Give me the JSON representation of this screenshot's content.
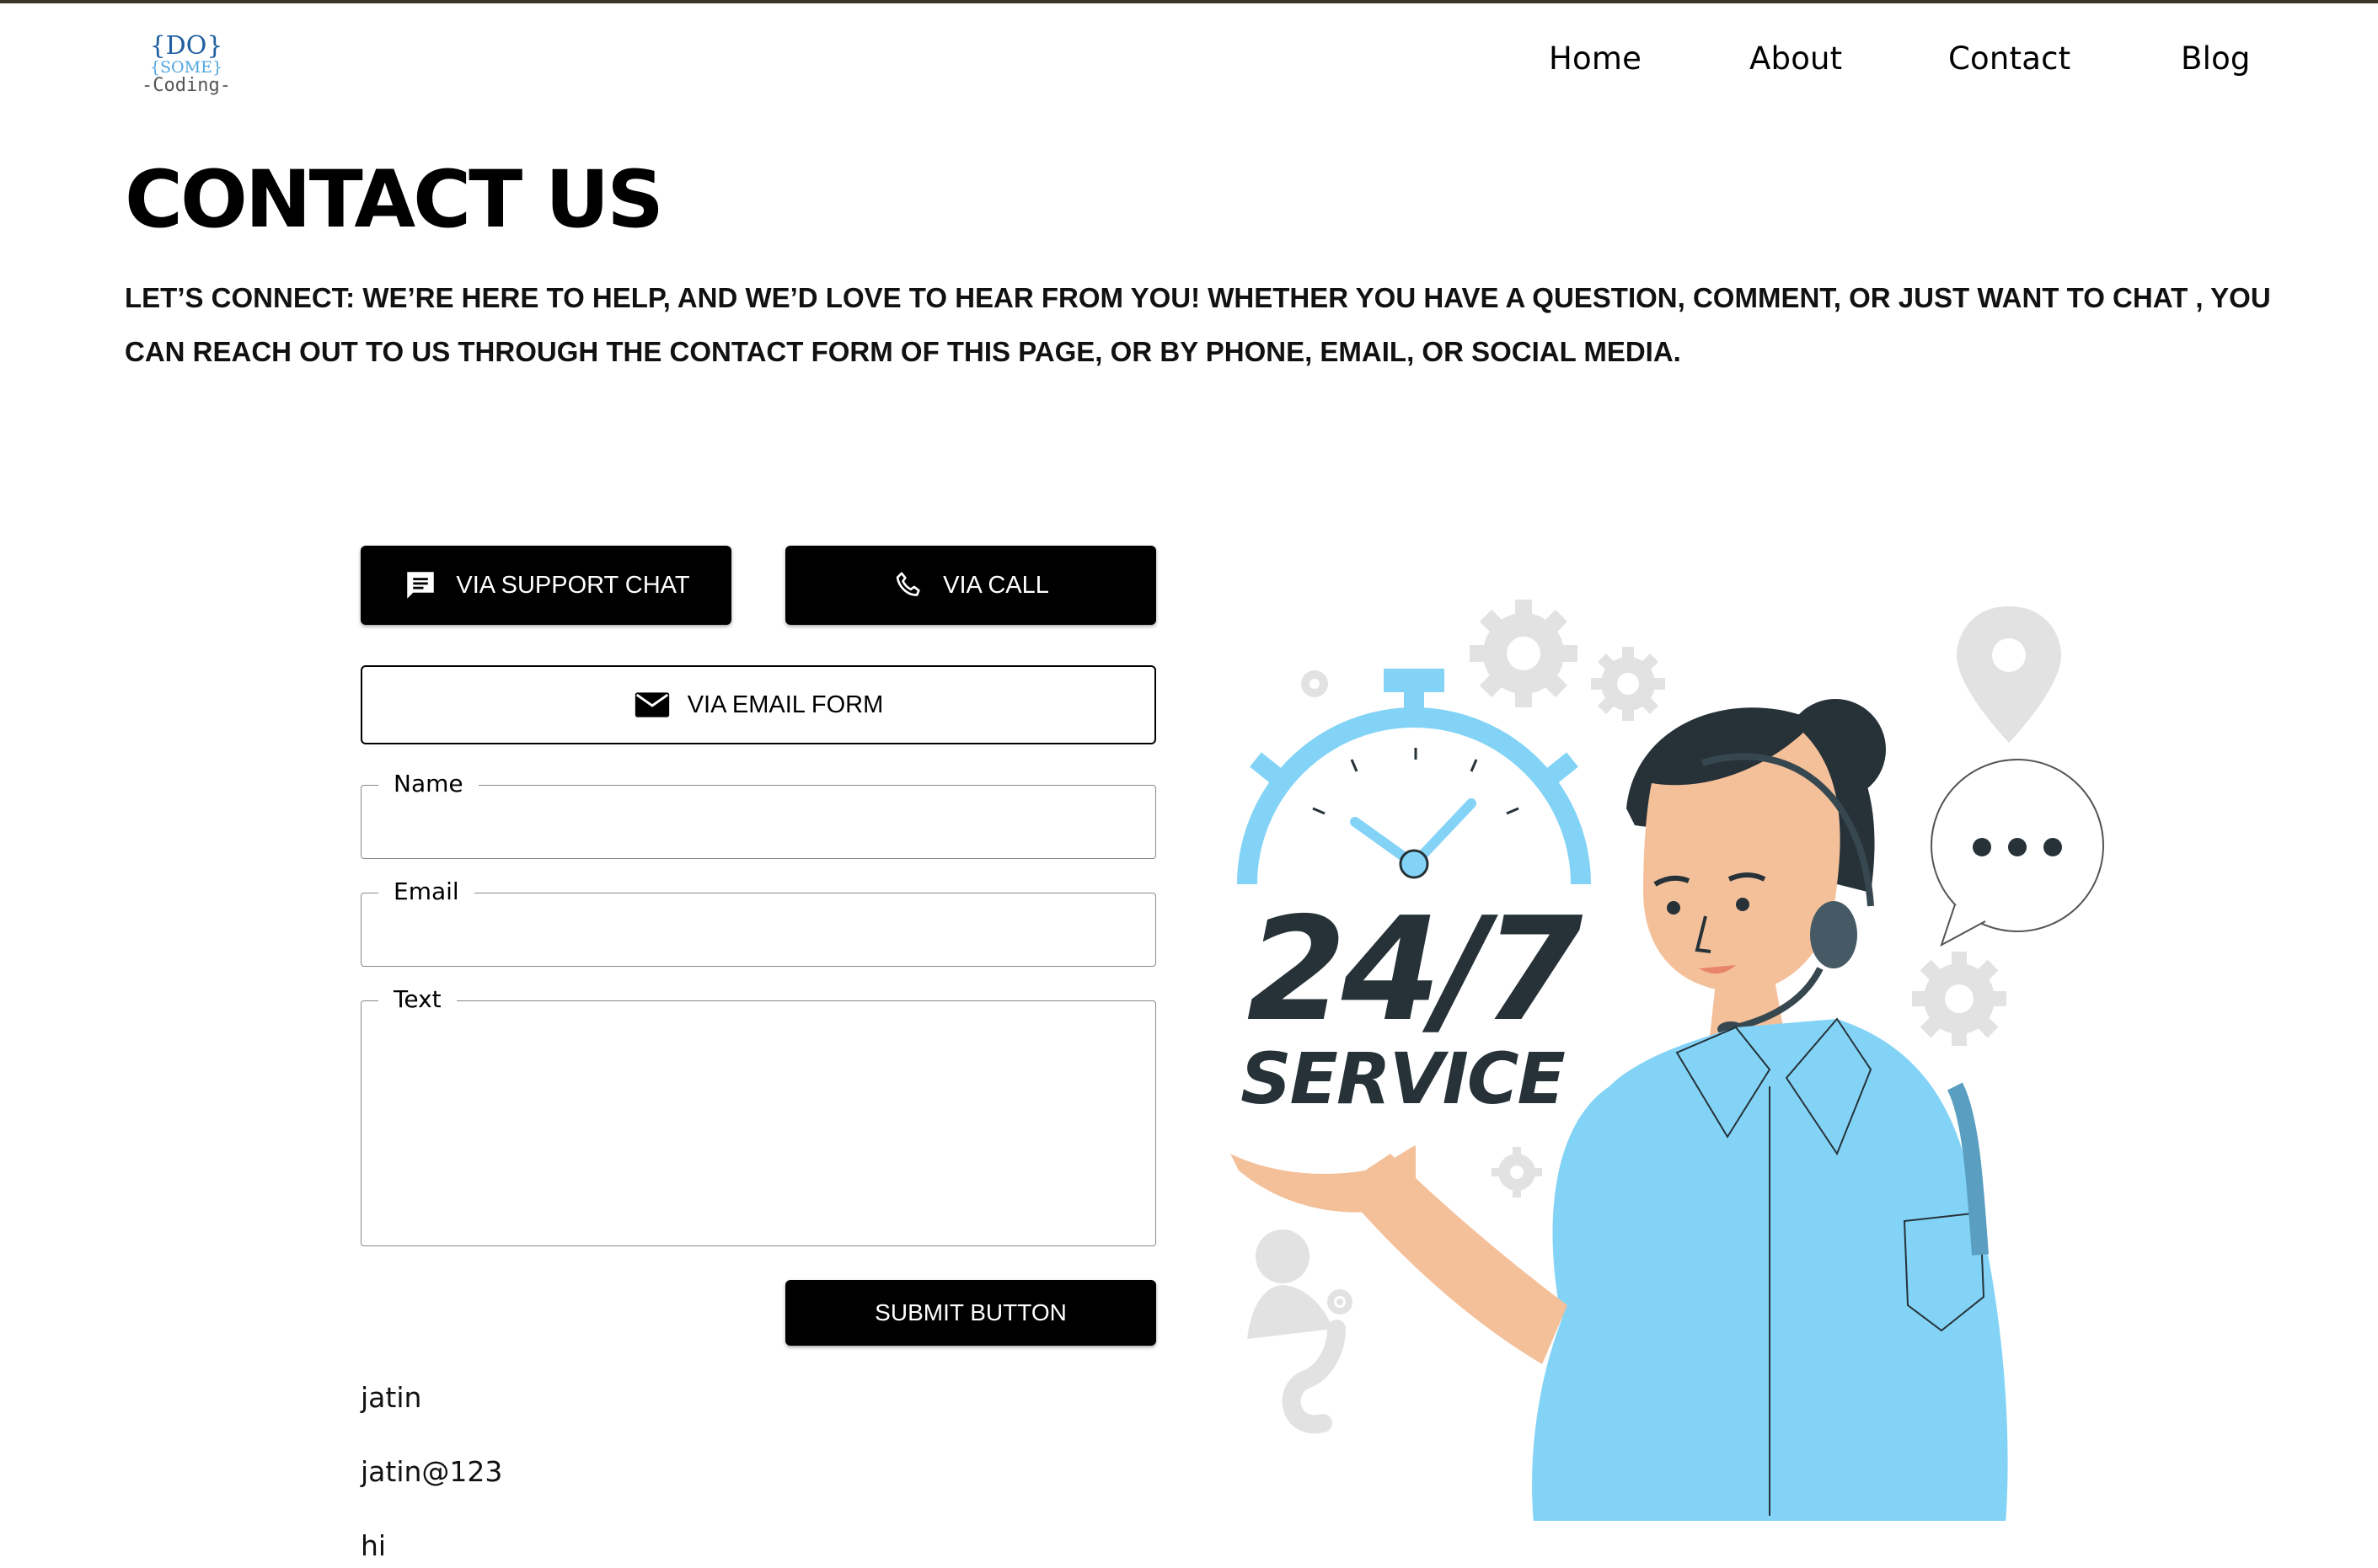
{
  "header": {
    "logo": {
      "line1": "{DO}",
      "line2": "{SOME}",
      "line3": "-Coding-"
    },
    "nav": [
      {
        "label": "Home"
      },
      {
        "label": "About"
      },
      {
        "label": "Contact"
      },
      {
        "label": "Blog"
      }
    ]
  },
  "hero": {
    "title": "CONTACT US",
    "intro": "LET’S CONNECT: WE’RE HERE TO HELP, AND WE’D LOVE TO HEAR FROM YOU! WHETHER YOU HAVE A QUESTION, COMMENT, OR JUST WANT TO CHAT , YOU CAN REACH OUT TO US THROUGH THE CONTACT FORM OF THIS PAGE, OR BY PHONE, EMAIL, OR SOCIAL MEDIA."
  },
  "contact_options": {
    "support_chat": "VIA SUPPORT CHAT",
    "call": "VIA CALL",
    "email_form": "VIA EMAIL FORM"
  },
  "form": {
    "name_label": "Name",
    "name_value": "",
    "email_label": "Email",
    "email_value": "",
    "text_label": "Text",
    "text_value": "",
    "submit_label": "SUBMIT BUTTON"
  },
  "submitted": {
    "name": "jatin",
    "email": "jatin@123",
    "text": "hi"
  },
  "illustration": {
    "headline": "24/7",
    "subline": "SERVICE"
  },
  "colors": {
    "accent_blue": "#83d3f7",
    "dark": "#263238",
    "skin": "#f4c09a",
    "gray": "#e4e4e4"
  }
}
